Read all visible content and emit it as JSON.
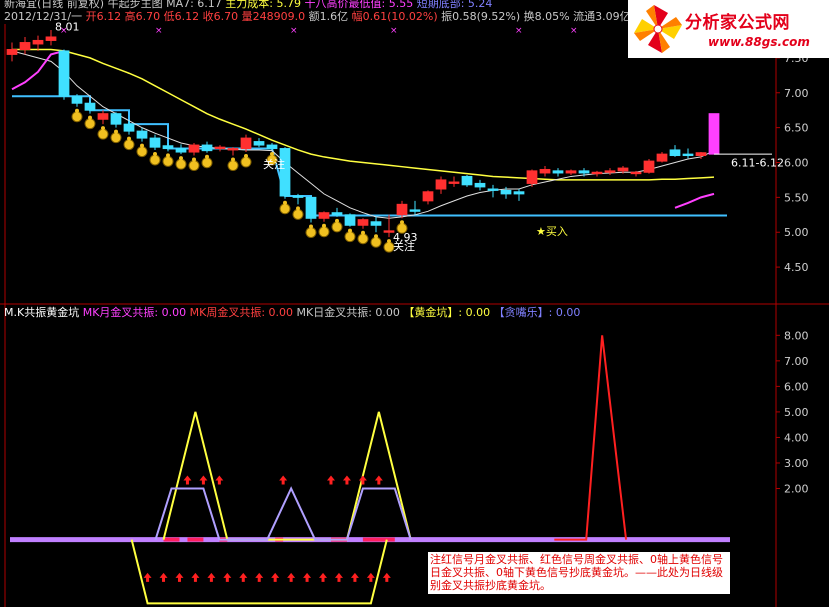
{
  "header": {
    "line1": [
      {
        "text": "新海宜(日线 前复权) 牛起步主图 ",
        "color": "w"
      },
      {
        "text": "MA7: 6.17 ",
        "color": "w"
      },
      {
        "text": "主力成本: 5.79 ",
        "color": "y"
      },
      {
        "text": "十八高价最低值: 5.55 ",
        "color": "m"
      },
      {
        "text": "短期底部: 5.24",
        "color": "b"
      }
    ],
    "line2": [
      {
        "text": "2012/12/31/一 ",
        "color": "w"
      },
      {
        "text": "开6.12 ",
        "color": "r"
      },
      {
        "text": "高6.70 ",
        "color": "r"
      },
      {
        "text": "低6.12 ",
        "color": "r"
      },
      {
        "text": "收6.70 ",
        "color": "r"
      },
      {
        "text": "量248909.0 ",
        "color": "r"
      },
      {
        "text": "额1.6亿 ",
        "color": "w"
      },
      {
        "text": "幅0.61(10.02%) ",
        "color": "r"
      },
      {
        "text": "振0.58(9.52%) ",
        "color": "w"
      },
      {
        "text": "换8.05% ",
        "color": "w"
      },
      {
        "text": "流通3.09亿",
        "color": "w"
      }
    ]
  },
  "indicator_header": [
    {
      "text": "M.K共振黄金坑  ",
      "color": "c"
    },
    {
      "text": "MK月金叉共振: 0.00  ",
      "color": "m"
    },
    {
      "text": "MK周金叉共振: 0.00  ",
      "color": "r"
    },
    {
      "text": "MK日金叉共振: 0.00  ",
      "color": "w"
    },
    {
      "text": "【黄金坑】: 0.00  ",
      "color": "y"
    },
    {
      "text": "【贪嘴乐】: 0.00",
      "color": "b"
    }
  ],
  "logo": {
    "title": "分析家公式网",
    "url": "www.88gs.com"
  },
  "annotation": "注红信号月金叉共振、红色信号周金叉共振、0轴上黄色信号日金叉共振、0轴下黄色信号抄底黄金坑。——此处为日线级别金叉共振抄底黄金坑。",
  "chart_data": [
    {
      "type": "candlestick",
      "title": "新海宜(日线 前复权)",
      "ylim": [
        4.1,
        7.9
      ],
      "y_ticks": [
        "7.50",
        "7.00",
        "6.50",
        "6.00",
        "5.50",
        "5.00",
        "4.50"
      ],
      "candles": [
        [
          7.55,
          7.72,
          7.45,
          7.62
        ],
        [
          7.62,
          7.8,
          7.55,
          7.72
        ],
        [
          7.7,
          7.82,
          7.6,
          7.75
        ],
        [
          7.75,
          7.9,
          7.68,
          7.8
        ],
        [
          7.6,
          7.62,
          6.9,
          6.95
        ],
        [
          6.95,
          6.98,
          6.8,
          6.85
        ],
        [
          6.85,
          6.88,
          6.7,
          6.75
        ],
        [
          6.62,
          6.75,
          6.55,
          6.7
        ],
        [
          6.7,
          6.72,
          6.5,
          6.55
        ],
        [
          6.55,
          6.6,
          6.4,
          6.45
        ],
        [
          6.45,
          6.5,
          6.3,
          6.35
        ],
        [
          6.35,
          6.4,
          6.18,
          6.22
        ],
        [
          6.24,
          6.28,
          6.16,
          6.2
        ],
        [
          6.2,
          6.26,
          6.12,
          6.15
        ],
        [
          6.15,
          6.28,
          6.1,
          6.25
        ],
        [
          6.25,
          6.3,
          6.14,
          6.17
        ],
        [
          6.2,
          6.25,
          6.16,
          6.22
        ],
        [
          6.18,
          6.22,
          6.1,
          6.2
        ],
        [
          6.2,
          6.4,
          6.15,
          6.35
        ],
        [
          6.3,
          6.35,
          6.22,
          6.25
        ],
        [
          6.25,
          6.28,
          6.18,
          6.2
        ],
        [
          6.2,
          6.22,
          5.48,
          5.52
        ],
        [
          5.52,
          5.55,
          5.4,
          5.5
        ],
        [
          5.5,
          5.52,
          5.14,
          5.2
        ],
        [
          5.2,
          5.3,
          5.15,
          5.28
        ],
        [
          5.28,
          5.35,
          5.22,
          5.25
        ],
        [
          5.25,
          5.27,
          5.08,
          5.1
        ],
        [
          5.1,
          5.2,
          5.05,
          5.18
        ],
        [
          5.15,
          5.22,
          5.0,
          5.1
        ],
        [
          5.0,
          5.25,
          4.93,
          5.02
        ],
        [
          5.25,
          5.45,
          5.2,
          5.4
        ],
        [
          5.32,
          5.45,
          5.25,
          5.3
        ],
        [
          5.45,
          5.6,
          5.4,
          5.58
        ],
        [
          5.62,
          5.8,
          5.55,
          5.75
        ],
        [
          5.7,
          5.8,
          5.65,
          5.72
        ],
        [
          5.8,
          5.82,
          5.65,
          5.68
        ],
        [
          5.7,
          5.75,
          5.6,
          5.65
        ],
        [
          5.62,
          5.68,
          5.5,
          5.6
        ],
        [
          5.6,
          5.65,
          5.48,
          5.55
        ],
        [
          5.58,
          5.62,
          5.45,
          5.55
        ],
        [
          5.7,
          5.9,
          5.65,
          5.88
        ],
        [
          5.85,
          5.95,
          5.8,
          5.9
        ],
        [
          5.88,
          5.92,
          5.8,
          5.85
        ],
        [
          5.85,
          5.9,
          5.82,
          5.88
        ],
        [
          5.88,
          5.92,
          5.8,
          5.85
        ],
        [
          5.84,
          5.88,
          5.8,
          5.86
        ],
        [
          5.86,
          5.92,
          5.82,
          5.88
        ],
        [
          5.88,
          5.95,
          5.84,
          5.92
        ],
        [
          5.84,
          5.88,
          5.8,
          5.86
        ],
        [
          5.86,
          6.05,
          5.84,
          6.02
        ],
        [
          6.02,
          6.15,
          6.0,
          6.12
        ],
        [
          6.18,
          6.25,
          6.08,
          6.1
        ],
        [
          6.12,
          6.2,
          6.06,
          6.1
        ],
        [
          6.1,
          6.15,
          6.05,
          6.14
        ],
        [
          6.12,
          6.7,
          6.12,
          6.7
        ]
      ],
      "ma_white": [
        7.6,
        7.55,
        7.5,
        7.45,
        7.3,
        7.1,
        6.95,
        6.8,
        6.7,
        6.6,
        6.5,
        6.42,
        6.35,
        6.28,
        6.24,
        6.22,
        6.2,
        6.19,
        6.18,
        6.18,
        6.17,
        6.0,
        5.85,
        5.7,
        5.55,
        5.45,
        5.35,
        5.28,
        5.22,
        5.2,
        5.22,
        5.25,
        5.3,
        5.38,
        5.45,
        5.52,
        5.57,
        5.6,
        5.62,
        5.62,
        5.68,
        5.72,
        5.76,
        5.8,
        5.82,
        5.84,
        5.85,
        5.86,
        5.86,
        5.9,
        5.95,
        6.0,
        6.05,
        6.08,
        6.17
      ],
      "ma_yellow": [
        7.62,
        7.62,
        7.62,
        7.62,
        7.6,
        7.55,
        7.5,
        7.42,
        7.35,
        7.28,
        7.2,
        7.1,
        7.0,
        6.9,
        6.8,
        6.7,
        6.62,
        6.55,
        6.48,
        6.4,
        6.32,
        6.25,
        6.18,
        6.12,
        6.08,
        6.05,
        6.02,
        6.0,
        5.98,
        5.96,
        5.94,
        5.92,
        5.9,
        5.88,
        5.86,
        5.84,
        5.82,
        5.8,
        5.79,
        5.78,
        5.77,
        5.76,
        5.75,
        5.75,
        5.75,
        5.75,
        5.75,
        5.75,
        5.75,
        5.75,
        5.76,
        5.76,
        5.77,
        5.78,
        5.79
      ],
      "magenta_line": {
        "start_index": 0,
        "values": [
          7.05,
          7.15,
          7.3,
          7.55,
          7.6
        ]
      },
      "magenta_line_end": {
        "start_index": 51,
        "values": [
          5.35,
          5.42,
          5.5,
          5.55
        ]
      },
      "short_bottom_steps": [
        [
          0,
          6.95
        ],
        [
          6,
          6.95
        ],
        [
          6,
          6.75
        ],
        [
          9,
          6.75
        ],
        [
          9,
          6.55
        ],
        [
          12,
          6.55
        ],
        [
          12,
          6.2
        ],
        [
          20,
          6.2
        ],
        [
          21,
          5.52
        ],
        [
          23,
          5.52
        ],
        [
          23,
          5.24
        ],
        [
          55,
          5.24
        ]
      ],
      "labels": [
        {
          "text": "8.01",
          "index": 3,
          "value": 7.95
        },
        {
          "text": "4.93",
          "index": 29,
          "value": 4.93
        },
        {
          "text": "6.11-6.12",
          "index": 55,
          "value": 6.0
        },
        {
          "text": "★买入",
          "index": 40,
          "value": 5.02
        },
        {
          "text": "关注",
          "index": 19,
          "value": 5.98
        },
        {
          "text": "关注",
          "index": 29,
          "value": 4.8
        }
      ],
      "coin_marks": [
        5,
        6,
        7,
        8,
        9,
        10,
        11,
        12,
        13,
        14,
        15,
        17,
        18,
        20,
        21,
        22,
        23,
        24,
        25,
        26,
        27,
        28,
        29,
        30
      ]
    },
    {
      "type": "line",
      "title": "M.K共振黄金坑",
      "ylim": [
        -0.8,
        8.6
      ],
      "y_ticks": [
        "8.00",
        "7.00",
        "6.00",
        "5.00",
        "4.00",
        "3.00",
        "2.00"
      ],
      "series": [
        {
          "color": "#ffff40",
          "points": [
            [
              9.5,
              0
            ],
            [
              11.5,
              5.0
            ],
            [
              13.5,
              0
            ],
            [
              21,
              0
            ],
            [
              23,
              5.0
            ],
            [
              25,
              0
            ]
          ]
        },
        {
          "color": "#ff2020",
          "points": [
            [
              34,
              0
            ],
            [
              36,
              0
            ],
            [
              37,
              8.0
            ],
            [
              38.5,
              0
            ]
          ]
        },
        {
          "color": "#b0a0ff",
          "points": [
            [
              9,
              0
            ],
            [
              10,
              2.0
            ],
            [
              12,
              2.0
            ],
            [
              13,
              0
            ],
            [
              16,
              0
            ],
            [
              17.5,
              2.0
            ],
            [
              19,
              0
            ],
            [
              21,
              0
            ],
            [
              22,
              2.0
            ],
            [
              24,
              2.0
            ],
            [
              25,
              0
            ]
          ]
        },
        {
          "color": "#ffff40",
          "points": [
            [
              7.5,
              0
            ],
            [
              8.5,
              -2.5
            ],
            [
              22.5,
              -2.5
            ],
            [
              23.5,
              0
            ]
          ]
        }
      ],
      "arrows_top": [
        11,
        12,
        13,
        17,
        20,
        21,
        22,
        23
      ],
      "arrows_bottom": [
        8.5,
        9.5,
        10.5,
        11.5,
        12.5,
        13.5,
        14.5,
        15.5,
        16.5,
        17.5,
        18.5,
        19.5,
        20.5,
        21.5,
        22.5,
        23.5
      ],
      "red_blocks": [
        [
          9.5,
          10.5
        ],
        [
          11,
          12
        ],
        [
          13,
          13.5
        ],
        [
          16.5,
          17
        ],
        [
          20,
          21
        ],
        [
          22,
          24
        ]
      ]
    }
  ]
}
